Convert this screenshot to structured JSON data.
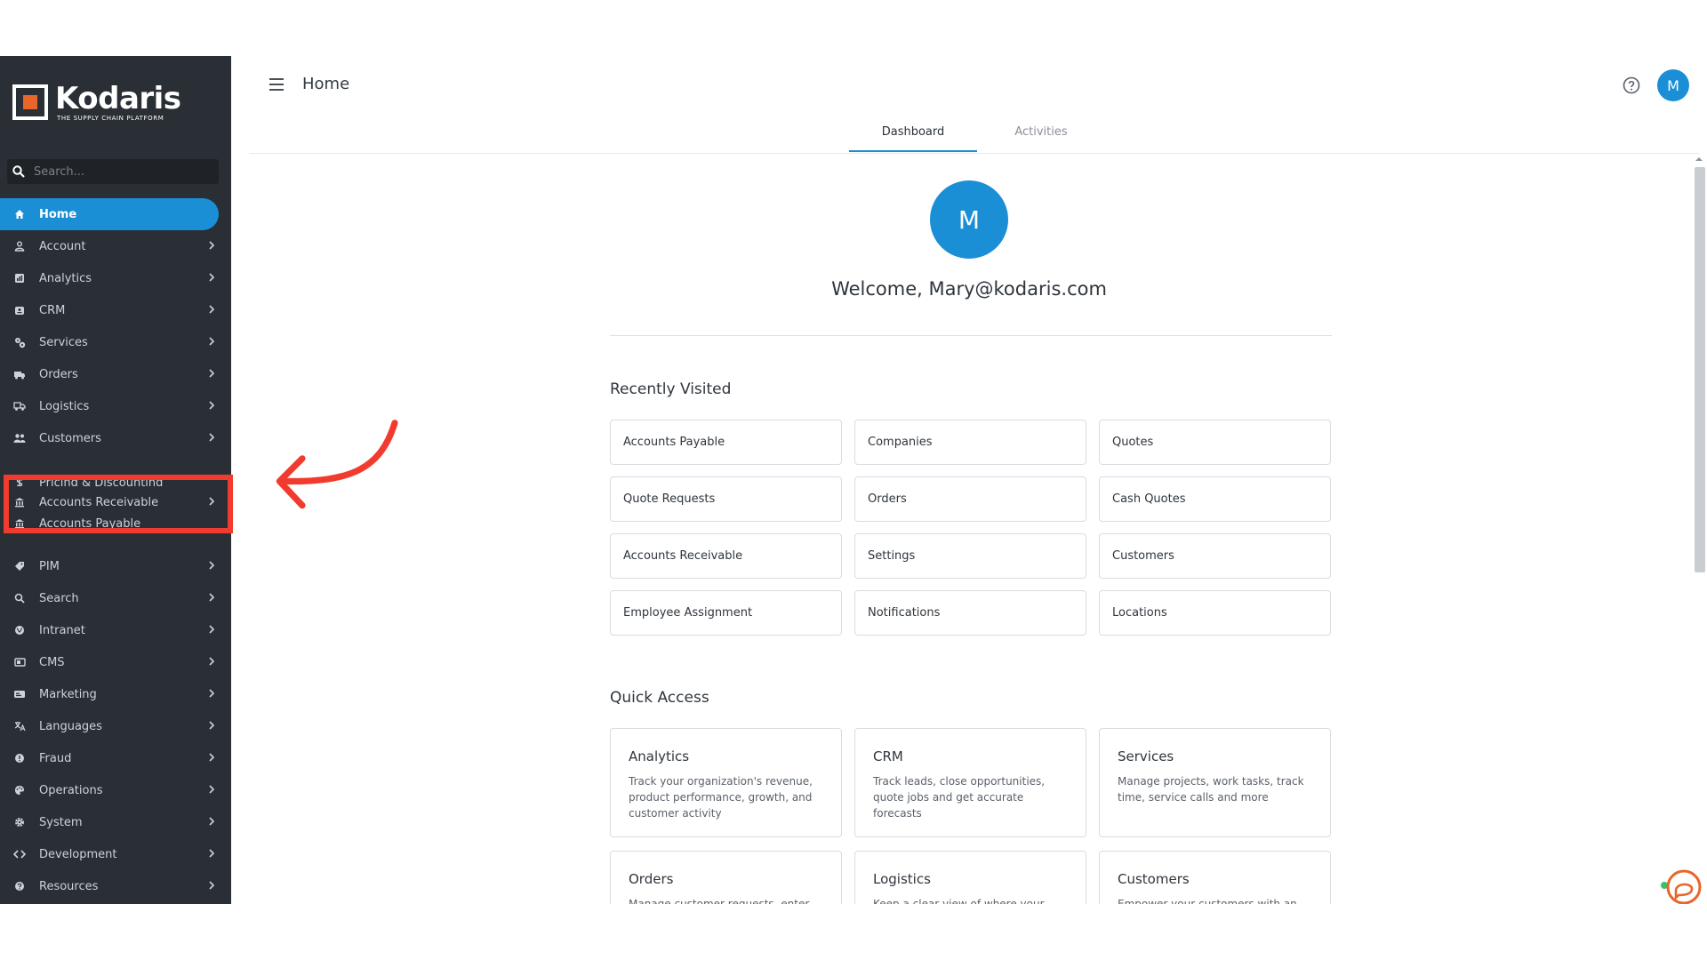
{
  "brand": {
    "name": "Kodaris",
    "tagline": "THE SUPPLY CHAIN PLATFORM",
    "accent": "#1a8fd6",
    "logo_color": "#e8662a"
  },
  "search": {
    "placeholder": "Search..."
  },
  "sidebar": {
    "items": [
      {
        "label": "Home",
        "icon": "home-icon"
      },
      {
        "label": "Account",
        "icon": "person-icon"
      },
      {
        "label": "Analytics",
        "icon": "chart-icon"
      },
      {
        "label": "CRM",
        "icon": "briefcase-icon"
      },
      {
        "label": "Services",
        "icon": "gears-icon"
      },
      {
        "label": "Orders",
        "icon": "truck-icon"
      },
      {
        "label": "Logistics",
        "icon": "shipping-icon"
      },
      {
        "label": "Customers",
        "icon": "people-icon"
      },
      {
        "label": "Pricing & Discounting",
        "icon": "dollar-icon"
      },
      {
        "label": "Accounts Receivable",
        "icon": "bank-icon"
      },
      {
        "label": "Accounts Payable",
        "icon": "bank-icon"
      },
      {
        "label": "PIM",
        "icon": "tag-icon"
      },
      {
        "label": "Search",
        "icon": "search-icon"
      },
      {
        "label": "Intranet",
        "icon": "globe-icon"
      },
      {
        "label": "CMS",
        "icon": "layout-icon"
      },
      {
        "label": "Marketing",
        "icon": "card-icon"
      },
      {
        "label": "Languages",
        "icon": "translate-icon"
      },
      {
        "label": "Fraud",
        "icon": "alert-icon"
      },
      {
        "label": "Operations",
        "icon": "palette-icon"
      },
      {
        "label": "System",
        "icon": "gear-icon"
      },
      {
        "label": "Development",
        "icon": "code-icon"
      },
      {
        "label": "Resources",
        "icon": "help-icon"
      }
    ]
  },
  "header": {
    "title": "Home",
    "avatar_initial": "M"
  },
  "tabs": [
    {
      "label": "Dashboard"
    },
    {
      "label": "Activities"
    }
  ],
  "main": {
    "avatar_initial": "M",
    "welcome": "Welcome, Mary@kodaris.com",
    "recently_visited": {
      "title": "Recently Visited",
      "items": [
        "Accounts Payable",
        "Companies",
        "Quotes",
        "Quote Requests",
        "Orders",
        "Cash Quotes",
        "Accounts Receivable",
        "Settings",
        "Customers",
        "Employee Assignment",
        "Notifications",
        "Locations"
      ]
    },
    "quick_access": {
      "title": "Quick Access",
      "items": [
        {
          "title": "Analytics",
          "desc": "Track your organization's revenue, product performance, growth, and customer activity"
        },
        {
          "title": "CRM",
          "desc": "Track leads, close opportunities, quote jobs and get accurate forecasts"
        },
        {
          "title": "Services",
          "desc": "Manage projects, work tasks, track time, service calls and more"
        },
        {
          "title": "Orders",
          "desc": "Manage customer requests, enter"
        },
        {
          "title": "Logistics",
          "desc": "Keep a clear view of where your"
        },
        {
          "title": "Customers",
          "desc": "Empower your customers with an"
        }
      ]
    }
  }
}
